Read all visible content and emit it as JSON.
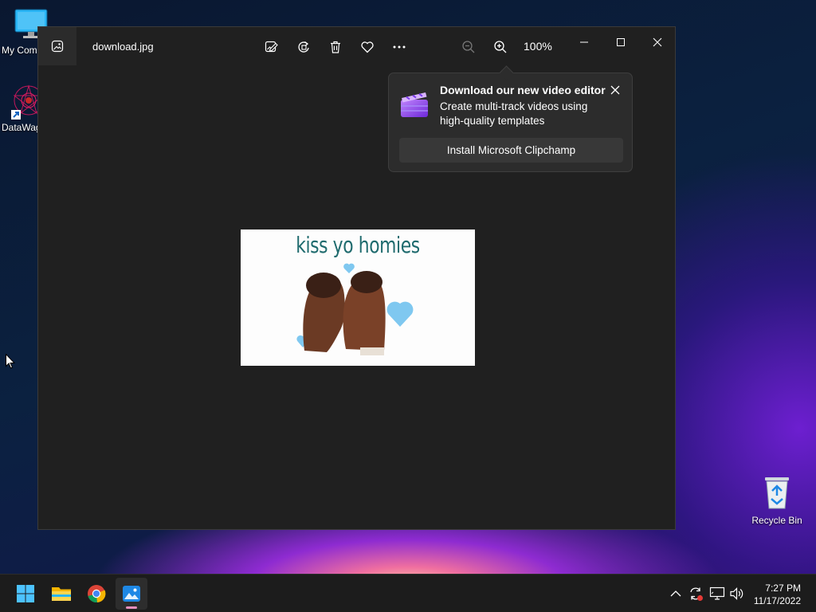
{
  "desktop": {
    "icons": [
      {
        "label": "My Com",
        "icon": "computer-icon"
      },
      {
        "label": "DataWag",
        "icon": "datawagon-shortcut-icon"
      },
      {
        "label": "Recycle Bin",
        "icon": "recycle-bin-icon"
      }
    ]
  },
  "photos_window": {
    "filename": "download.jpg",
    "zoom_label": "100%",
    "toolbar_icons": [
      "edit-image-icon",
      "rotate-icon",
      "delete-icon",
      "favorite-heart-icon",
      "more-options-icon",
      "zoom-out-icon",
      "zoom-in-icon"
    ],
    "window_controls": [
      "minimize-icon",
      "maximize-icon",
      "close-icon"
    ],
    "image_caption": "kiss yo homies"
  },
  "toast": {
    "title": "Download our new video editor",
    "body": "Create multi-track videos using high-quality templates",
    "button_label": "Install Microsoft Clipchamp"
  },
  "taskbar": {
    "apps": [
      "start-windows-icon",
      "file-explorer-icon",
      "chrome-icon",
      "photos-icon"
    ],
    "tray_icons": [
      "show-hidden-icons-chevron",
      "update-sync-icon",
      "network-icon",
      "volume-icon"
    ],
    "time": "7:27 PM",
    "date": "11/17/2022"
  },
  "colors": {
    "accent": "#4cc2ff",
    "window_bg": "#202020",
    "toast_bg": "#2c2c2c",
    "taskbar_bg": "#1c1c1c",
    "caption_teal": "#1f6b6e"
  }
}
